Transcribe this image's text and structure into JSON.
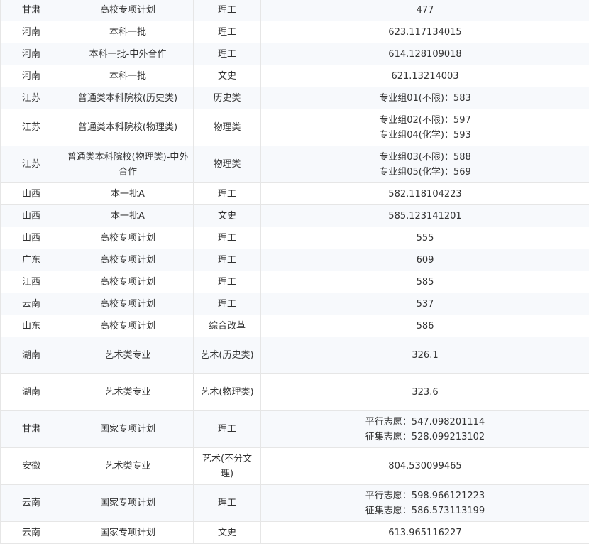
{
  "rows": [
    {
      "province": "甘肃",
      "batch": "高校专项计划",
      "category": "理工",
      "score": [
        "477"
      ]
    },
    {
      "province": "河南",
      "batch": "本科一批",
      "category": "理工",
      "score": [
        "623.117134015"
      ]
    },
    {
      "province": "河南",
      "batch": "本科一批-中外合作",
      "category": "理工",
      "score": [
        "614.128109018"
      ]
    },
    {
      "province": "河南",
      "batch": "本科一批",
      "category": "文史",
      "score": [
        "621.13214003"
      ]
    },
    {
      "province": "江苏",
      "batch": "普通类本科院校(历史类)",
      "category": "历史类",
      "score": [
        "专业组01(不限)：583"
      ]
    },
    {
      "province": "江苏",
      "batch": "普通类本科院校(物理类)",
      "category": "物理类",
      "score": [
        "专业组02(不限)：597",
        "专业组04(化学)：593"
      ]
    },
    {
      "province": "江苏",
      "batch": "普通类本科院校(物理类)-中外合作",
      "category": "物理类",
      "score": [
        "专业组03(不限)：588",
        "专业组05(化学)：569"
      ]
    },
    {
      "province": "山西",
      "batch": "本一批A",
      "category": "理工",
      "score": [
        "582.118104223"
      ]
    },
    {
      "province": "山西",
      "batch": "本一批A",
      "category": "文史",
      "score": [
        "585.123141201"
      ]
    },
    {
      "province": "山西",
      "batch": "高校专项计划",
      "category": "理工",
      "score": [
        "555"
      ]
    },
    {
      "province": "广东",
      "batch": "高校专项计划",
      "category": "理工",
      "score": [
        "609"
      ]
    },
    {
      "province": "江西",
      "batch": "高校专项计划",
      "category": "理工",
      "score": [
        "585"
      ]
    },
    {
      "province": "云南",
      "batch": "高校专项计划",
      "category": "理工",
      "score": [
        "537"
      ]
    },
    {
      "province": "山东",
      "batch": "高校专项计划",
      "category": "综合改革",
      "score": [
        "586"
      ]
    },
    {
      "province": "湖南",
      "batch": "艺术类专业",
      "category": "艺术(历史类)",
      "score": [
        "326.1"
      ]
    },
    {
      "province": "湖南",
      "batch": "艺术类专业",
      "category": "艺术(物理类)",
      "score": [
        "323.6"
      ]
    },
    {
      "province": "甘肃",
      "batch": "国家专项计划",
      "category": "理工",
      "score": [
        "平行志愿：547.098201114",
        "征集志愿：528.099213102"
      ]
    },
    {
      "province": "安徽",
      "batch": "艺术类专业",
      "category": "艺术(不分文理)",
      "score": [
        "804.530099465"
      ]
    },
    {
      "province": "云南",
      "batch": "国家专项计划",
      "category": "理工",
      "score": [
        "平行志愿：598.966121223",
        "征集志愿：586.573113199"
      ]
    },
    {
      "province": "云南",
      "batch": "国家专项计划",
      "category": "文史",
      "score": [
        "613.965116227"
      ]
    }
  ]
}
